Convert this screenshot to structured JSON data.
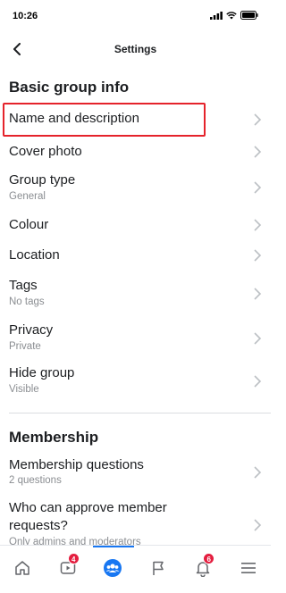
{
  "status": {
    "time": "10:26"
  },
  "nav": {
    "title": "Settings"
  },
  "sections": {
    "basic": {
      "title": "Basic group info",
      "rows": [
        {
          "label": "Name and description",
          "sub": ""
        },
        {
          "label": "Cover photo",
          "sub": ""
        },
        {
          "label": "Group type",
          "sub": "General"
        },
        {
          "label": "Colour",
          "sub": ""
        },
        {
          "label": "Location",
          "sub": ""
        },
        {
          "label": "Tags",
          "sub": "No tags"
        },
        {
          "label": "Privacy",
          "sub": "Private"
        },
        {
          "label": "Hide group",
          "sub": "Visible"
        }
      ]
    },
    "membership": {
      "title": "Membership",
      "rows": [
        {
          "label": "Membership questions",
          "sub": "2 questions"
        },
        {
          "label": "Who can approve member",
          "label2": "requests?",
          "sub": "Only admins and moderators"
        }
      ]
    }
  },
  "tabs": [
    {
      "icon": "home-icon",
      "badge": ""
    },
    {
      "icon": "video-icon",
      "badge": "4"
    },
    {
      "icon": "groups-icon",
      "badge": ""
    },
    {
      "icon": "flag-icon",
      "badge": ""
    },
    {
      "icon": "bell-icon",
      "badge": "6"
    },
    {
      "icon": "menu-icon",
      "badge": ""
    }
  ],
  "colors": {
    "accent": "#1877f2",
    "highlight": "#e5232b",
    "badge": "#e41e3f"
  }
}
